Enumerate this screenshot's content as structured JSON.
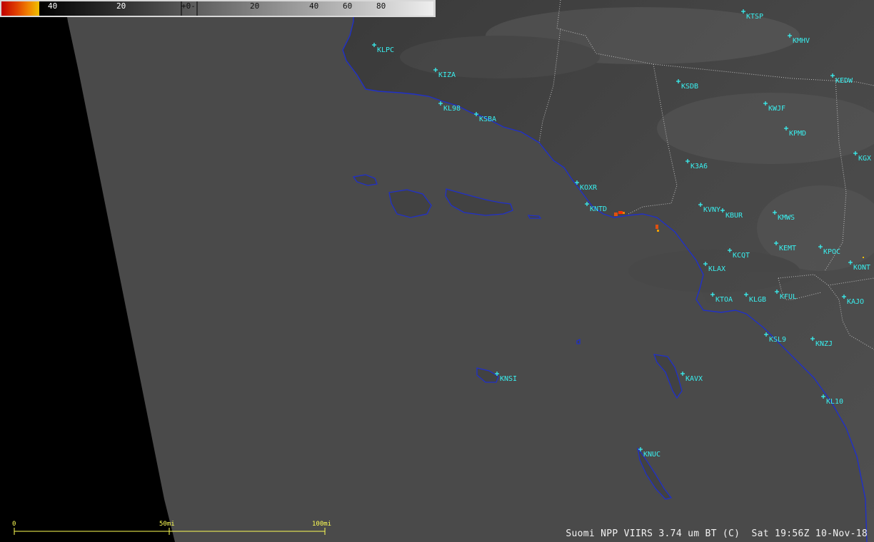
{
  "caption": "Suomi NPP VIIRS 3.74 um BT (C)  Sat 19:56Z 10-Nov-18",
  "colorbar": {
    "ticks": [
      "40",
      "20",
      "+0-",
      "20",
      "40",
      "60",
      "80"
    ],
    "hot_colors": [
      "#c00000",
      "#e04000",
      "#f08000",
      "#f0b000"
    ]
  },
  "scale_bar": {
    "labels": [
      "0",
      "50mi",
      "100mi"
    ]
  },
  "colors": {
    "coastline": "#2030c8",
    "station": "#39f0f0",
    "ocean": "#4a4a4a",
    "no_data": "#000000",
    "county_lines": "#bfbfbf",
    "fire_hotspot": "#e05010"
  },
  "stations": [
    {
      "id": "KTSP"
    },
    {
      "id": "KMHV"
    },
    {
      "id": "KLPC"
    },
    {
      "id": "KIZA"
    },
    {
      "id": "KEDW"
    },
    {
      "id": "KSDB"
    },
    {
      "id": "KL98"
    },
    {
      "id": "KSBA"
    },
    {
      "id": "KWJF"
    },
    {
      "id": "KPMD"
    },
    {
      "id": "KGX"
    },
    {
      "id": "K3A6"
    },
    {
      "id": "KOXR"
    },
    {
      "id": "KNTD"
    },
    {
      "id": "KVNY"
    },
    {
      "id": "KBUR"
    },
    {
      "id": "KMWS"
    },
    {
      "id": "KEMT"
    },
    {
      "id": "KPOC"
    },
    {
      "id": "KCQT"
    },
    {
      "id": "KLAX"
    },
    {
      "id": "KONT"
    },
    {
      "id": "KTOA"
    },
    {
      "id": "KLGB"
    },
    {
      "id": "KFUL"
    },
    {
      "id": "KAJO"
    },
    {
      "id": "KSL9"
    },
    {
      "id": "KNZJ"
    },
    {
      "id": "KNSI"
    },
    {
      "id": "KAVX"
    },
    {
      "id": "KL10"
    },
    {
      "id": "KNUC"
    }
  ]
}
